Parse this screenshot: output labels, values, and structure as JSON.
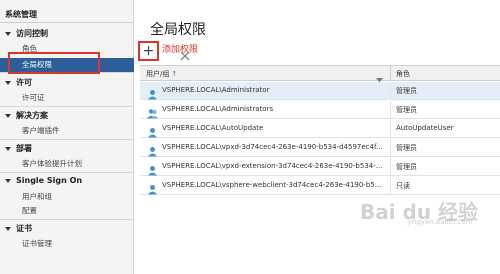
{
  "sidebar": {
    "header": "系统管理",
    "groups": [
      {
        "label": "访问控制",
        "items": [
          "角色",
          "全局权限"
        ]
      },
      {
        "label": "许可",
        "items": [
          "许可证"
        ]
      },
      {
        "label": "解决方案",
        "items": [
          "客户端插件"
        ]
      },
      {
        "label": "部署",
        "items": [
          "客户体验提升计划"
        ]
      },
      {
        "label": "Single Sign On",
        "items": [
          "用户和组",
          "配置"
        ]
      },
      {
        "label": "证书",
        "items": [
          "证书管理"
        ]
      }
    ],
    "active_item": "全局权限"
  },
  "main": {
    "title": "全局权限",
    "add_label": "添加权限",
    "columns": {
      "user_group": "用户/组",
      "role": "角色"
    },
    "rows": [
      {
        "user": "VSPHERE.LOCAL\\Administrator",
        "role": "管理员",
        "selected": true
      },
      {
        "user": "VSPHERE.LOCAL\\Administrators",
        "role": "管理员",
        "selected": false
      },
      {
        "user": "VSPHERE.LOCAL\\AutoUpdate",
        "role": "AutoUpdateUser",
        "selected": false
      },
      {
        "user": "VSPHERE.LOCAL\\vpxd-3d74cec4-263e-4190-b534-d4597ec4f...",
        "role": "管理员",
        "selected": false
      },
      {
        "user": "VSPHERE.LOCAL\\vpxd-extension-3d74cec4-263e-4190-b534-...",
        "role": "管理员",
        "selected": false
      },
      {
        "user": "VSPHERE.LOCAL\\vsphere-webclient-3d74cec4-263e-4190-b5...",
        "role": "只读",
        "selected": false
      }
    ]
  },
  "watermark": {
    "text": "Bai du 经验",
    "sub": "jingyan.baidu.com"
  },
  "colors": {
    "active": "#2c5f99",
    "annotation": "#e0342a",
    "selected_row": "#e3eef9"
  }
}
